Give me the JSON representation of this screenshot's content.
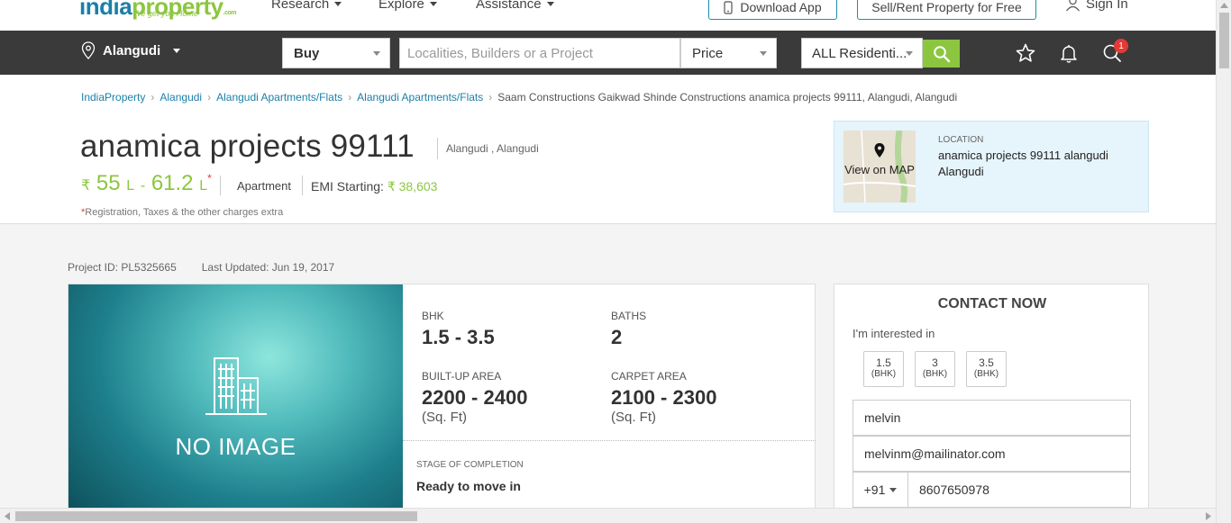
{
  "header": {
    "logo_main_blue": "india",
    "logo_main_green": "property",
    "logo_com": ".com",
    "logo_tagline": "We get you Home",
    "nav": [
      "Research",
      "Explore",
      "Assistance"
    ],
    "download_app": "Download App",
    "sell_rent": "Sell/Rent Property for Free",
    "sign_in": "Sign In"
  },
  "searchbar": {
    "city": "Alangudi",
    "mode": "Buy",
    "placeholder": "Localities, Builders or a Project",
    "price": "Price",
    "property_type": "ALL Residenti...",
    "notification_count": "1"
  },
  "breadcrumb": [
    "IndiaProperty",
    "Alangudi",
    "Alangudi Apartments/Flats",
    "Alangudi Apartments/Flats",
    "Saam Constructions Gaikwad Shinde Constructions anamica projects 99111, Alangudi, Alangudi"
  ],
  "project": {
    "title": "anamica projects 99111",
    "subtitle": "Alangudi , Alangudi",
    "price_symbol": "₹",
    "price_low": "55",
    "price_low_unit": "L",
    "price_dash": "-",
    "price_high": "61.2",
    "price_high_unit": "L",
    "price_star": "*",
    "type": "Apartment",
    "emi_label": "EMI Starting:",
    "emi_value": "₹ 38,603",
    "reg_star": "*",
    "reg_note": "Registration, Taxes & the other charges extra"
  },
  "location": {
    "map_label": "View on MAP",
    "label": "LOCATION",
    "value": "anamica projects 99111 alangudi Alangudi"
  },
  "meta": {
    "project_id": "Project ID: PL5325665",
    "updated": "Last Updated: Jun 19, 2017"
  },
  "card": {
    "no_image": "NO IMAGE",
    "specs": [
      {
        "label": "BHK",
        "value": "1.5 - 3.5",
        "unit": ""
      },
      {
        "label": "BATHS",
        "value": "2",
        "unit": ""
      },
      {
        "label": "BUILT-UP AREA",
        "value": "2200 - 2400",
        "unit": "(Sq. Ft)"
      },
      {
        "label": "CARPET AREA",
        "value": "2100 - 2300",
        "unit": "(Sq. Ft)"
      }
    ],
    "stage_label": "STAGE OF COMPLETION",
    "stage_value": "Ready to move in"
  },
  "contact": {
    "title": "CONTACT NOW",
    "interested": "I'm interested in",
    "bhk_options": [
      {
        "value": "1.5",
        "unit": "(BHK)"
      },
      {
        "value": "3",
        "unit": "(BHK)"
      },
      {
        "value": "3.5",
        "unit": "(BHK)"
      }
    ],
    "name": "melvin",
    "email": "melvinm@mailinator.com",
    "country_code": "+91",
    "phone": "8607650978"
  }
}
